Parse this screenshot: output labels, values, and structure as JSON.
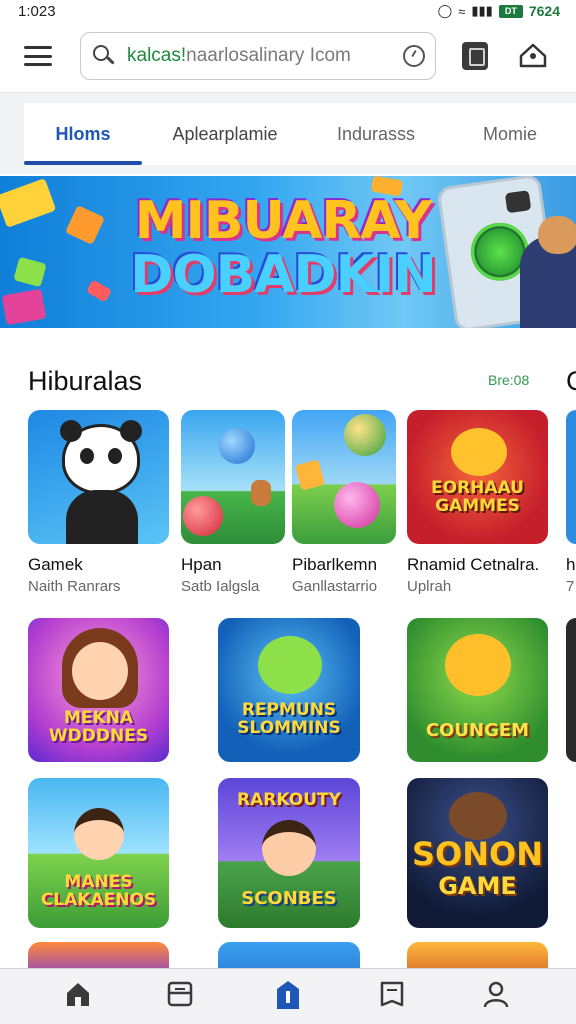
{
  "status_bar": {
    "time": "1:023",
    "battery_label": "DT",
    "battery_text": "7624"
  },
  "search": {
    "text_highlight": "kalcas!",
    "text_rest": "naarlosalinary Icom"
  },
  "tabs": [
    {
      "label": "Hloms",
      "active": true
    },
    {
      "label": "Aplearplamie",
      "active": false
    },
    {
      "label": "Indurasss",
      "active": false
    },
    {
      "label": "Momie",
      "active": false
    }
  ],
  "banner": {
    "line1": "MIBUARAY",
    "line2": "DOBADKIN"
  },
  "section": {
    "title": "Hiburalas",
    "link": "Bre:08",
    "extra": "C"
  },
  "row1": [
    {
      "name": "Gamek",
      "sub": "Naith Ranrars"
    },
    {
      "name": "Hpan",
      "sub": "Satb Ialgsla"
    },
    {
      "name": "Pibarlkemn",
      "sub": "Ganllastarrio"
    },
    {
      "name": "Rnamid Cetnalra.",
      "sub": "Uplrah",
      "tile_text": "EORHAAU GAMMES"
    },
    {
      "name": "h",
      "sub": "7"
    }
  ],
  "tiles": {
    "t1": "MEKNA WDDDNES",
    "t2": "REPMUNS SLOMMINS",
    "t3": "COUNGEM",
    "t4": "MANES CLAKAENOS",
    "t5_top": "RARKOUTY",
    "t5_bottom": "SCONBES",
    "t6_top": "SONON",
    "t6_bottom": "GAME"
  },
  "colors": {
    "accent_blue": "#1f4ea8",
    "link_green": "#2f9c4c",
    "active_nav": "#1f57b6"
  },
  "nav": [
    {
      "icon": "home-icon"
    },
    {
      "icon": "apps-icon"
    },
    {
      "icon": "games-icon",
      "active": true
    },
    {
      "icon": "books-icon"
    },
    {
      "icon": "profile-icon"
    }
  ]
}
